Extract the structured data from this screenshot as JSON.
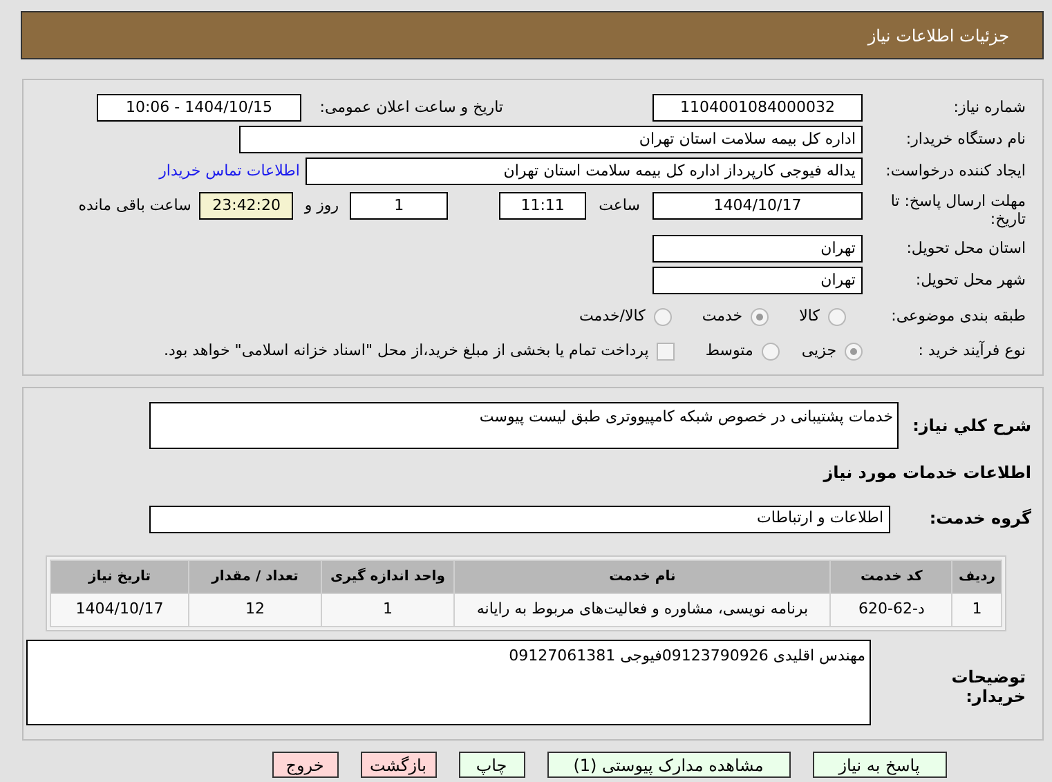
{
  "header": {
    "title": "جزئیات اطلاعات نیاز"
  },
  "need_number": {
    "label": "شماره نیاز:",
    "value": "1104001084000032"
  },
  "announce": {
    "label": "تاریخ و ساعت اعلان عمومی:",
    "value": "1404/10/15 - 10:06"
  },
  "buyer_org": {
    "label": "نام دستگاه خریدار:",
    "value": "اداره کل بیمه سلامت استان تهران"
  },
  "requester": {
    "label": "ایجاد کننده درخواست:",
    "value": "یداله فیوجی کارپرداز اداره کل بیمه سلامت استان تهران",
    "link": "اطلاعات تماس خریدار"
  },
  "deadline": {
    "label": "مهلت ارسال پاسخ: تا تاریخ:",
    "date": "1404/10/17",
    "time_label": "ساعت",
    "time": "11:11",
    "days": "1",
    "days_label": "روز و",
    "remaining": "23:42:20",
    "remaining_label": "ساعت باقی مانده"
  },
  "province": {
    "label": "استان محل تحویل:",
    "value": "تهران"
  },
  "city": {
    "label": "شهر محل تحویل:",
    "value": "تهران"
  },
  "category": {
    "label": "طبقه بندی موضوعی:",
    "options": [
      {
        "label": "کالا",
        "selected": false
      },
      {
        "label": "خدمت",
        "selected": true
      },
      {
        "label": "کالا/خدمت",
        "selected": false
      }
    ]
  },
  "purchase_type": {
    "label": "نوع فرآیند خرید :",
    "options": [
      {
        "label": "جزیی",
        "selected": true
      },
      {
        "label": "متوسط",
        "selected": false
      }
    ],
    "checkbox": {
      "label": "پرداخت تمام یا بخشی از مبلغ خرید،از محل \"اسناد خزانه اسلامی\" خواهد بود.",
      "checked": false
    }
  },
  "description": {
    "label": "شرح كلي نياز:",
    "value": "خدمات پشتیبانی در خصوص شبکه  کامپیووتری طبق لیست پیوست"
  },
  "services_title": "اطلاعات خدمات مورد نياز",
  "service_group": {
    "label": "گروه خدمت:",
    "value": "اطلاعات و ارتباطات"
  },
  "table": {
    "columns": [
      "ردیف",
      "کد خدمت",
      "نام خدمت",
      "واحد اندازه گیری",
      "تعداد / مقدار",
      "تاریخ نیاز"
    ],
    "rows": [
      [
        "1",
        "د-62-620",
        "برنامه نویسی، مشاوره و فعالیت‌های مربوط به رایانه",
        "1",
        "12",
        "1404/10/17"
      ]
    ]
  },
  "buyer_notes": {
    "label": "توضیحات خریدار:",
    "value": "مهندس اقلیدی 09123790926فیوجی 09127061381"
  },
  "buttons": [
    {
      "label": "پاسخ به نیاز",
      "kind": "action"
    },
    {
      "label": "مشاهده مدارک پیوستی (1)",
      "kind": "action"
    },
    {
      "label": "چاپ",
      "kind": "action"
    },
    {
      "label": "بازگشت",
      "kind": "exit"
    },
    {
      "label": "خروج",
      "kind": "exit"
    }
  ]
}
